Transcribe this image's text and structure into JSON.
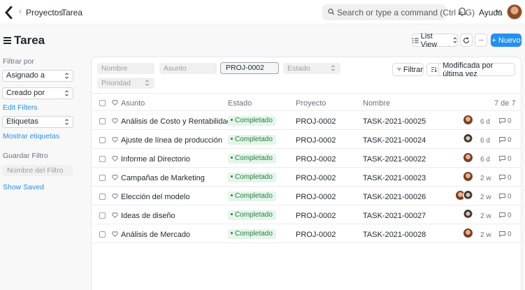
{
  "navbar": {
    "breadcrumbs": [
      "Proyectos",
      "Tarea"
    ],
    "search_placeholder": "Search or type a command (Ctrl + G)",
    "help_label": "Ayuda"
  },
  "page": {
    "title": "Tarea",
    "list_view_label": "List View",
    "new_label": "+ Nuevo",
    "more_label": "···"
  },
  "sidebar": {
    "filter_by_label": "Filtrar por",
    "assigned_to": "Asignado a",
    "created_by": "Creado por",
    "edit_filters": "Edit Filters",
    "tags": "Etiquetas",
    "show_tags": "Mostrar etiquetas",
    "save_filter_label": "Guardar Filtro",
    "filter_name_placeholder": "Nombre del Filtro",
    "show_saved": "Show Saved"
  },
  "filters": {
    "name_placeholder": "Nombre",
    "subject_placeholder": "Asunto",
    "project_value": "PROJ-0002",
    "status_placeholder": "Estado",
    "priority_placeholder": "Prioridad",
    "filter_button": "Filtrar",
    "sort_label": "Modificada por última vez"
  },
  "table": {
    "headers": {
      "subject": "Asunto",
      "status": "Estado",
      "project": "Proyecto",
      "name": "Nombre",
      "count": "7 de 7"
    },
    "rows": [
      {
        "subject": "Análisis de Costo y Rentabilidad",
        "status": "Completado",
        "project": "PROJ-0002",
        "name": "TASK-2021-00025",
        "age": "6 d",
        "comments": "0"
      },
      {
        "subject": "Ajuste de línea de producción",
        "status": "Completado",
        "project": "PROJ-0002",
        "name": "TASK-2021-00024",
        "age": "6 d",
        "comments": "0"
      },
      {
        "subject": "Informe al Directorio",
        "status": "Completado",
        "project": "PROJ-0002",
        "name": "TASK-2021-00022",
        "age": "6 d",
        "comments": "0"
      },
      {
        "subject": "Campañas de Marketing",
        "status": "Completado",
        "project": "PROJ-0002",
        "name": "TASK-2021-00023",
        "age": "2 w",
        "comments": "0"
      },
      {
        "subject": "Elección del modelo",
        "status": "Completado",
        "project": "PROJ-0002",
        "name": "TASK-2021-00026",
        "age": "2 w",
        "comments": "0"
      },
      {
        "subject": "Ideas de diseño",
        "status": "Completado",
        "project": "PROJ-0002",
        "name": "TASK-2021-00027",
        "age": "2 w",
        "comments": "0"
      },
      {
        "subject": "Análisis de Mercado",
        "status": "Completado",
        "project": "PROJ-0002",
        "name": "TASK-2021-00028",
        "age": "2 w",
        "comments": "0"
      }
    ]
  },
  "colors": {
    "primary": "#2490ef",
    "status_bg": "#e4f5e9",
    "status_text": "#2f7d45"
  }
}
